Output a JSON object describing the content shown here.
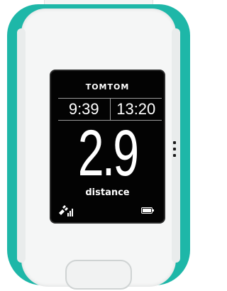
{
  "watch": {
    "brand": "TOMTOM",
    "time_left": "9:39",
    "time_right": "13:20",
    "value": "2.9",
    "metric_label": "distance"
  },
  "icons": {
    "gps": "gps-signal-icon",
    "battery": "battery-icon",
    "menu": "menu-dots-icon"
  },
  "colors": {
    "strap": "#1eb7a8",
    "bezel": "#f5f6f6",
    "screen": "#030303",
    "text": "#ffffff"
  }
}
